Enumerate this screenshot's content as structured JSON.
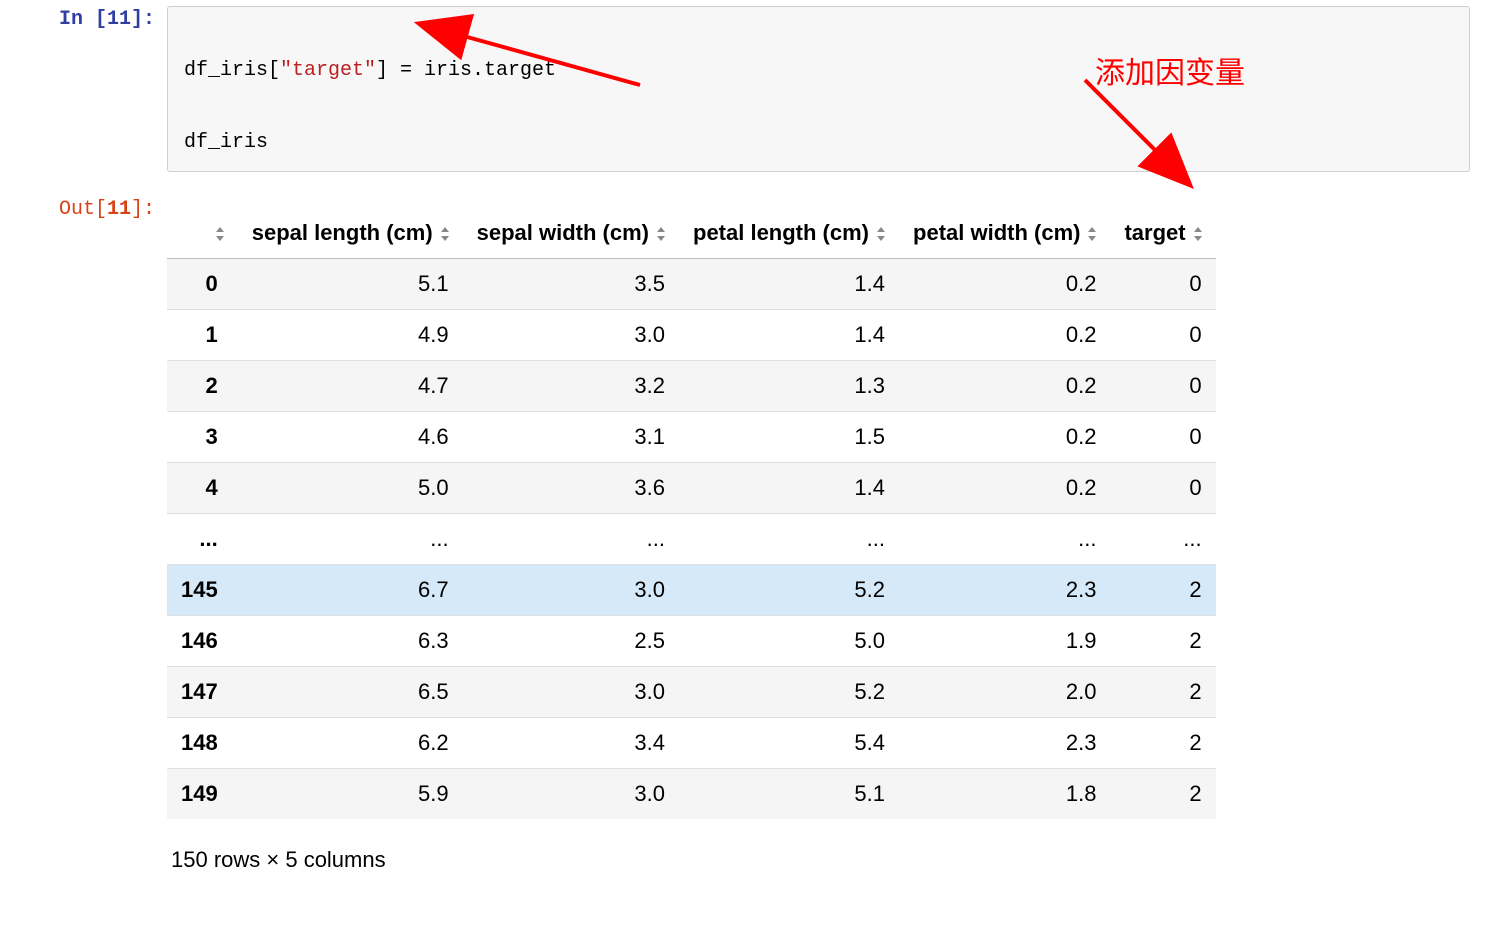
{
  "cell": {
    "in_prompt_prefix": "In [",
    "in_prompt_num": "11",
    "in_prompt_suffix": "]:",
    "out_prompt_prefix": "Out[",
    "out_prompt_num": "11",
    "out_prompt_suffix": "]:",
    "code_line1_a": "df_iris[",
    "code_line1_str": "\"target\"",
    "code_line1_b": "] = iris.target",
    "code_line2": "df_iris"
  },
  "annotation": {
    "label": "添加因变量"
  },
  "table": {
    "columns": [
      "sepal length (cm)",
      "sepal width (cm)",
      "petal length (cm)",
      "petal width (cm)",
      "target"
    ],
    "rows": [
      {
        "idx": "0",
        "v": [
          "5.1",
          "3.5",
          "1.4",
          "0.2",
          "0"
        ],
        "hover": false
      },
      {
        "idx": "1",
        "v": [
          "4.9",
          "3.0",
          "1.4",
          "0.2",
          "0"
        ],
        "hover": false
      },
      {
        "idx": "2",
        "v": [
          "4.7",
          "3.2",
          "1.3",
          "0.2",
          "0"
        ],
        "hover": false
      },
      {
        "idx": "3",
        "v": [
          "4.6",
          "3.1",
          "1.5",
          "0.2",
          "0"
        ],
        "hover": false
      },
      {
        "idx": "4",
        "v": [
          "5.0",
          "3.6",
          "1.4",
          "0.2",
          "0"
        ],
        "hover": false
      },
      {
        "idx": "...",
        "v": [
          "...",
          "...",
          "...",
          "...",
          "..."
        ],
        "hover": false
      },
      {
        "idx": "145",
        "v": [
          "6.7",
          "3.0",
          "5.2",
          "2.3",
          "2"
        ],
        "hover": true
      },
      {
        "idx": "146",
        "v": [
          "6.3",
          "2.5",
          "5.0",
          "1.9",
          "2"
        ],
        "hover": false
      },
      {
        "idx": "147",
        "v": [
          "6.5",
          "3.0",
          "5.2",
          "2.0",
          "2"
        ],
        "hover": false
      },
      {
        "idx": "148",
        "v": [
          "6.2",
          "3.4",
          "5.4",
          "2.3",
          "2"
        ],
        "hover": false
      },
      {
        "idx": "149",
        "v": [
          "5.9",
          "3.0",
          "5.1",
          "1.8",
          "2"
        ],
        "hover": false
      }
    ],
    "shape_caption": "150 rows × 5 columns"
  }
}
